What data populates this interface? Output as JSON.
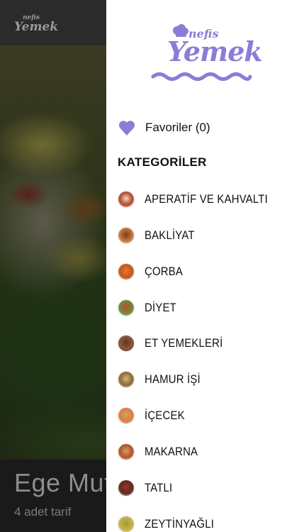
{
  "background": {
    "logo_small": "nefis",
    "logo_big": "Yemek",
    "title": "Ege Mutfa",
    "subtitle": "4 adet tarif"
  },
  "drawer": {
    "brand": {
      "nefis": "nefis",
      "yemek": "Yemek"
    },
    "favorites_label": "Favoriler (0)",
    "categories_heading": "KATEGORİLER",
    "categories": [
      {
        "label": "APERATİF VE KAHVALTI",
        "colors": [
          "#e9d9c2",
          "#b5462e",
          "#f1eee6"
        ]
      },
      {
        "label": "BAKLİYAT",
        "colors": [
          "#7a3b22",
          "#c27a3e",
          "#f4eee6"
        ]
      },
      {
        "label": "ÇORBA",
        "colors": [
          "#e07a2a",
          "#c4561a",
          "#f3e1c6"
        ]
      },
      {
        "label": "DİYET",
        "colors": [
          "#c84a2c",
          "#6b8a3a",
          "#f0e2c6"
        ]
      },
      {
        "label": "ET YEMEKLERİ",
        "colors": [
          "#5a3424",
          "#8f5a3a",
          "#3a2a20"
        ]
      },
      {
        "label": "HAMUR İŞİ",
        "colors": [
          "#d9b27a",
          "#8a6a3a",
          "#f2e6cc"
        ]
      },
      {
        "label": "İÇECEK",
        "colors": [
          "#c9a66a",
          "#e07a3a",
          "#efe4d6"
        ]
      },
      {
        "label": "MAKARNA",
        "colors": [
          "#d0a060",
          "#b4502c",
          "#f6efe4"
        ]
      },
      {
        "label": "TATLI",
        "colors": [
          "#a0302a",
          "#5a2c1e",
          "#f2ebe4"
        ]
      },
      {
        "label": "ZEYTİNYAĞLI",
        "colors": [
          "#9aa03a",
          "#c9b04a",
          "#f0ead6"
        ]
      }
    ],
    "accent_color": "#8a7dd6"
  }
}
